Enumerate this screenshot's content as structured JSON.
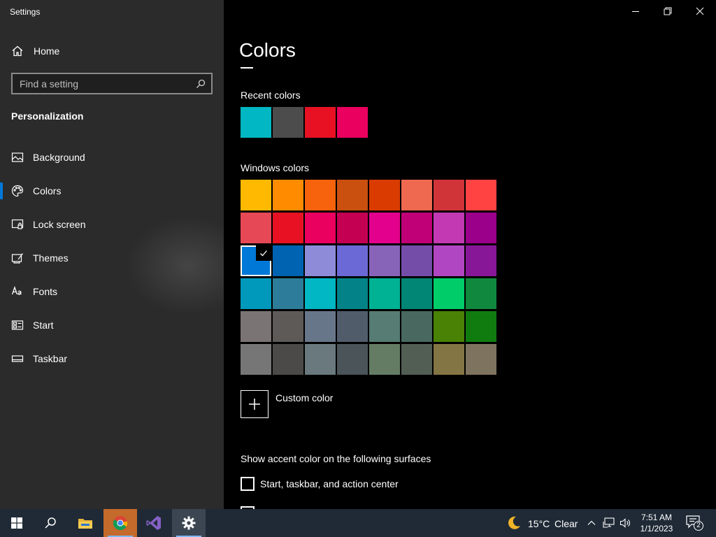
{
  "window": {
    "title": "Settings"
  },
  "sidebar": {
    "home_label": "Home",
    "search_placeholder": "Find a setting",
    "section_title": "Personalization",
    "items": [
      {
        "label": "Background",
        "icon": "picture-icon"
      },
      {
        "label": "Colors",
        "icon": "palette-icon"
      },
      {
        "label": "Lock screen",
        "icon": "lock-screen-icon"
      },
      {
        "label": "Themes",
        "icon": "themes-icon"
      },
      {
        "label": "Fonts",
        "icon": "fonts-icon"
      },
      {
        "label": "Start",
        "icon": "start-icon"
      },
      {
        "label": "Taskbar",
        "icon": "taskbar-icon"
      }
    ],
    "active_item": "Colors"
  },
  "main": {
    "title": "Colors",
    "recent_colors_label": "Recent colors",
    "recent_colors": [
      "#00b7c3",
      "#4c4c4c",
      "#e81123",
      "#ea005e"
    ],
    "windows_colors_label": "Windows colors",
    "windows_colors": [
      [
        "#ffb900",
        "#ff8c00",
        "#f7630c",
        "#ca5010",
        "#da3b01",
        "#ef6950",
        "#d13438",
        "#ff4343"
      ],
      [
        "#e74856",
        "#e81123",
        "#ea005e",
        "#c30052",
        "#e3008c",
        "#bf0077",
        "#c239b3",
        "#9a0089"
      ],
      [
        "#0078d7",
        "#0063b1",
        "#8e8cd8",
        "#6b69d6",
        "#8764b8",
        "#744da9",
        "#b146c2",
        "#881798"
      ],
      [
        "#0099bc",
        "#2d7d9a",
        "#00b7c3",
        "#038387",
        "#00b294",
        "#018574",
        "#00cc6a",
        "#10893e"
      ],
      [
        "#7a7574",
        "#5d5a58",
        "#68768a",
        "#515c6b",
        "#567c73",
        "#486860",
        "#498205",
        "#107c10"
      ],
      [
        "#767676",
        "#4c4a48",
        "#69797e",
        "#4a5459",
        "#647c64",
        "#525e54",
        "#847545",
        "#7e735f"
      ]
    ],
    "selected_color": "#0078d7",
    "custom_color_label": "Custom color",
    "accent_surfaces_label": "Show accent color on the following surfaces",
    "checkbox_start_label": "Start, taskbar, and action center",
    "checkbox_start_checked": false
  },
  "taskbar": {
    "weather_temp": "15°C",
    "weather_condition": "Clear",
    "time": "7:51 AM",
    "date": "1/1/2023",
    "notification_count": "2",
    "pinned": [
      "file-explorer-icon",
      "chrome-icon",
      "visual-studio-icon",
      "settings-icon"
    ]
  }
}
